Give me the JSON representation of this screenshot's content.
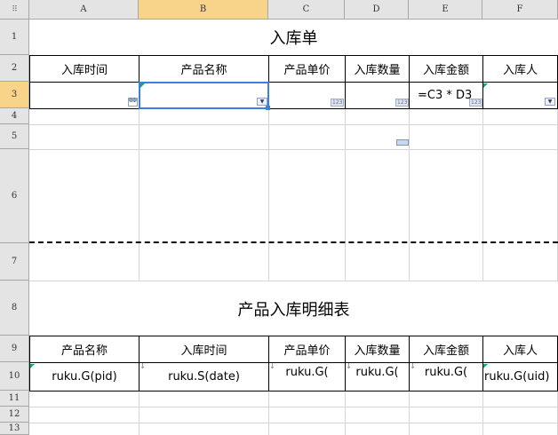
{
  "columns": [
    "A",
    "B",
    "C",
    "D",
    "E",
    "F"
  ],
  "rows": [
    "1",
    "2",
    "3",
    "4",
    "5",
    "6",
    "7",
    "8",
    "9",
    "10",
    "11",
    "12",
    "13"
  ],
  "corner_glyph": "⠿",
  "form": {
    "title": "入库单",
    "headers": [
      "入库时间",
      "产品名称",
      "产品单价",
      "入库数量",
      "入库金额",
      "入库人"
    ],
    "formula": "=C3 * D3",
    "num_tag": "123",
    "cal_tag": "31"
  },
  "detail": {
    "title": "产品入库明细表",
    "headers": [
      "产品名称",
      "入库时间",
      "产品单价",
      "入库数量",
      "入库金额",
      "入库人"
    ],
    "values": [
      "ruku.G(pid)",
      "ruku.S(date)",
      "ruku.G(",
      "ruku.G(",
      "ruku.G(",
      "ruku.G(uid)"
    ]
  },
  "selected_cell": "B3",
  "colors": {
    "selection": "#3d7fe0",
    "header_selected": "#f7d48a",
    "header_bg": "#e4e4e4"
  }
}
